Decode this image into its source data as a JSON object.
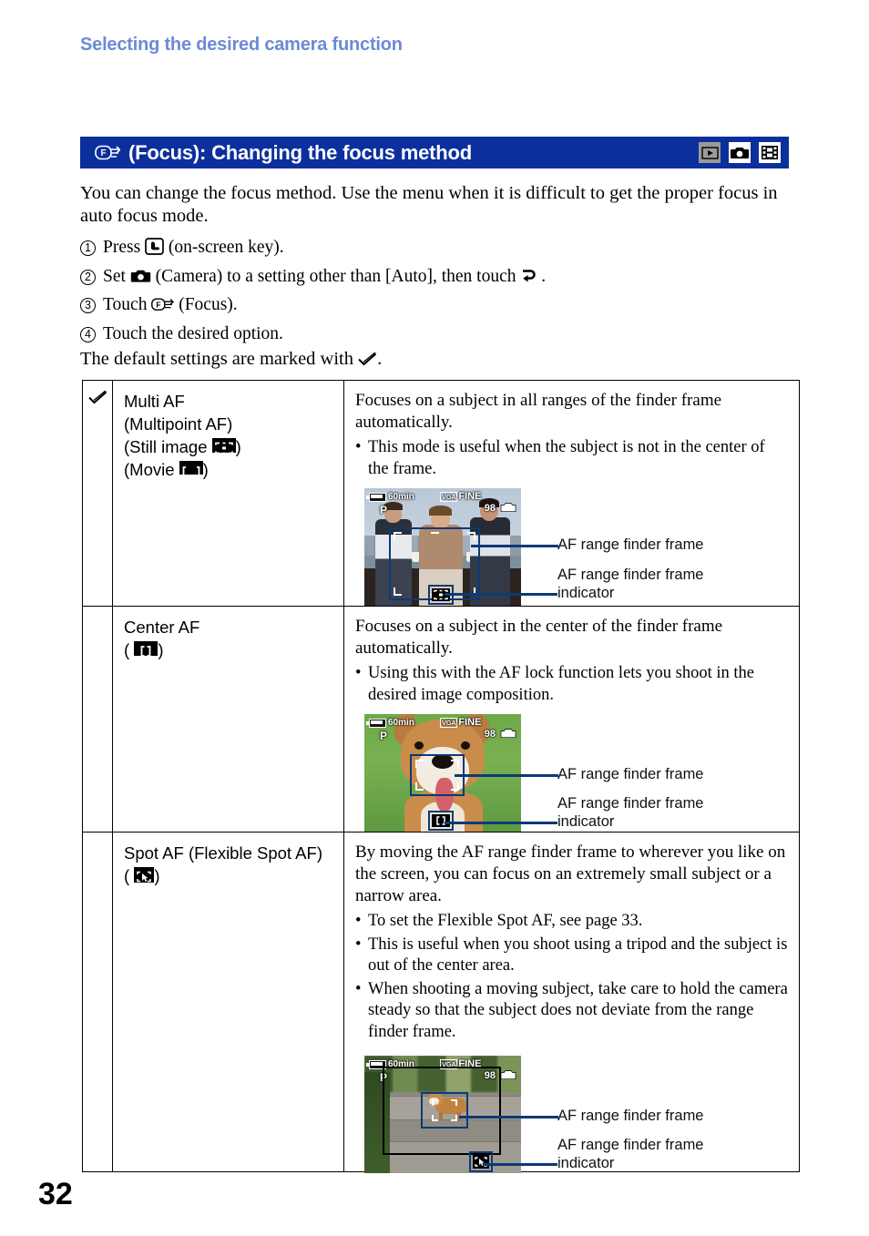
{
  "running_head": "Selecting the desired camera function",
  "title": {
    "icon": "focus-icon",
    "text": "(Focus): Changing the focus method",
    "mode_icons": [
      {
        "name": "playback-mode-icon",
        "glyph": "play",
        "state": "dimmed"
      },
      {
        "name": "still-camera-mode-icon",
        "glyph": "camera",
        "state": "active"
      },
      {
        "name": "movie-mode-icon",
        "glyph": "film",
        "state": "active"
      }
    ]
  },
  "intro": "You can change the focus method. Use the menu when it is difficult to get the proper focus in auto focus mode.",
  "steps": [
    {
      "num": "1",
      "pre": "Press",
      "icon": "on-screen-key-icon",
      "post": "(on-screen key)."
    },
    {
      "num": "2",
      "pre": "Set",
      "icon": "camera-icon",
      "post": "(Camera) to a setting other than [Auto], then touch",
      "icon2": "return-icon",
      "post2": "."
    },
    {
      "num": "3",
      "pre": "Touch",
      "icon": "focus-icon",
      "post": "(Focus)."
    },
    {
      "num": "4",
      "pre": "Touch the desired option.",
      "icon": "",
      "post": ""
    }
  ],
  "default_note": {
    "pre": "The default settings are marked with",
    "icon": "check-icon",
    "post": "."
  },
  "table": {
    "rows": [
      {
        "checked": true,
        "check_icon": "check-icon",
        "label_lines": [
          "Multi AF",
          "(Multipoint AF)",
          "(Still image ",
          "(Movie "
        ],
        "label": {
          "line1": "Multi AF",
          "line2": "(Multipoint AF)",
          "line3_pre": "(Still image",
          "line3_icon": "multi-af-still-icon",
          "line3_post": ")",
          "line4_pre": "(Movie",
          "line4_icon": "multi-af-movie-icon",
          "line4_post": ")"
        },
        "description": "Focuses on a subject in all ranges of the finder frame automatically.",
        "bullets": [
          "This mode is useful when the subject is not in the center of the frame."
        ],
        "figure": {
          "scene": "three-people-city",
          "lcd": {
            "battery": "60min",
            "mode": "P",
            "image_size": "VGA",
            "quality": "FINE",
            "shots_remaining": "98"
          },
          "callouts": [
            {
              "name": "af-range-finder-frame-callout",
              "text": "AF range finder frame"
            },
            {
              "name": "af-range-finder-frame-indicator-callout",
              "line1": "AF range finder frame",
              "line2": "indicator"
            }
          ]
        }
      },
      {
        "checked": false,
        "label": {
          "line1": "Center AF",
          "line2_pre": "(",
          "line2_icon": "center-af-icon",
          "line2_post": ")"
        },
        "description": "Focuses on a subject in the center of the finder frame automatically.",
        "bullets": [
          "Using this with the AF lock function lets you shoot in the desired image composition."
        ],
        "figure": {
          "scene": "dog-on-grass",
          "lcd": {
            "battery": "60min",
            "mode": "P",
            "image_size": "VGA",
            "quality": "FINE",
            "shots_remaining": "98"
          },
          "callouts": [
            {
              "name": "af-range-finder-frame-callout",
              "text": "AF range finder frame"
            },
            {
              "name": "af-range-finder-frame-indicator-callout",
              "line1": "AF range finder frame",
              "line2": "indicator"
            }
          ]
        }
      },
      {
        "checked": false,
        "label": {
          "line1": "Spot AF (Flexible Spot AF)",
          "line2_pre": "(",
          "line2_icon": "spot-af-icon",
          "line2_post": ")"
        },
        "description": "By moving the AF range finder frame to wherever you like on the screen, you can focus on an extremely small subject or a narrow area.",
        "bullets": [
          "To set the Flexible Spot AF, see page 33.",
          "This is useful when you shoot using a tripod and the subject is out of the center area.",
          "When shooting a moving subject, take care to hold the camera steady so that the subject does not deviate from the range finder frame."
        ],
        "figure": {
          "scene": "dog-on-steps",
          "lcd": {
            "battery": "60min",
            "mode": "P",
            "image_size": "VGA",
            "quality": "FINE",
            "shots_remaining": "98"
          },
          "callouts": [
            {
              "name": "af-range-finder-frame-callout",
              "text": "AF range finder frame"
            },
            {
              "name": "af-range-finder-frame-indicator-callout",
              "line1": "AF range finder frame",
              "line2": "indicator"
            }
          ]
        }
      }
    ]
  },
  "page_number": "32",
  "colors": {
    "running_head": "#6b8ad4",
    "title_bar": "#0b2f9c",
    "callout_line": "#0b3a76"
  }
}
